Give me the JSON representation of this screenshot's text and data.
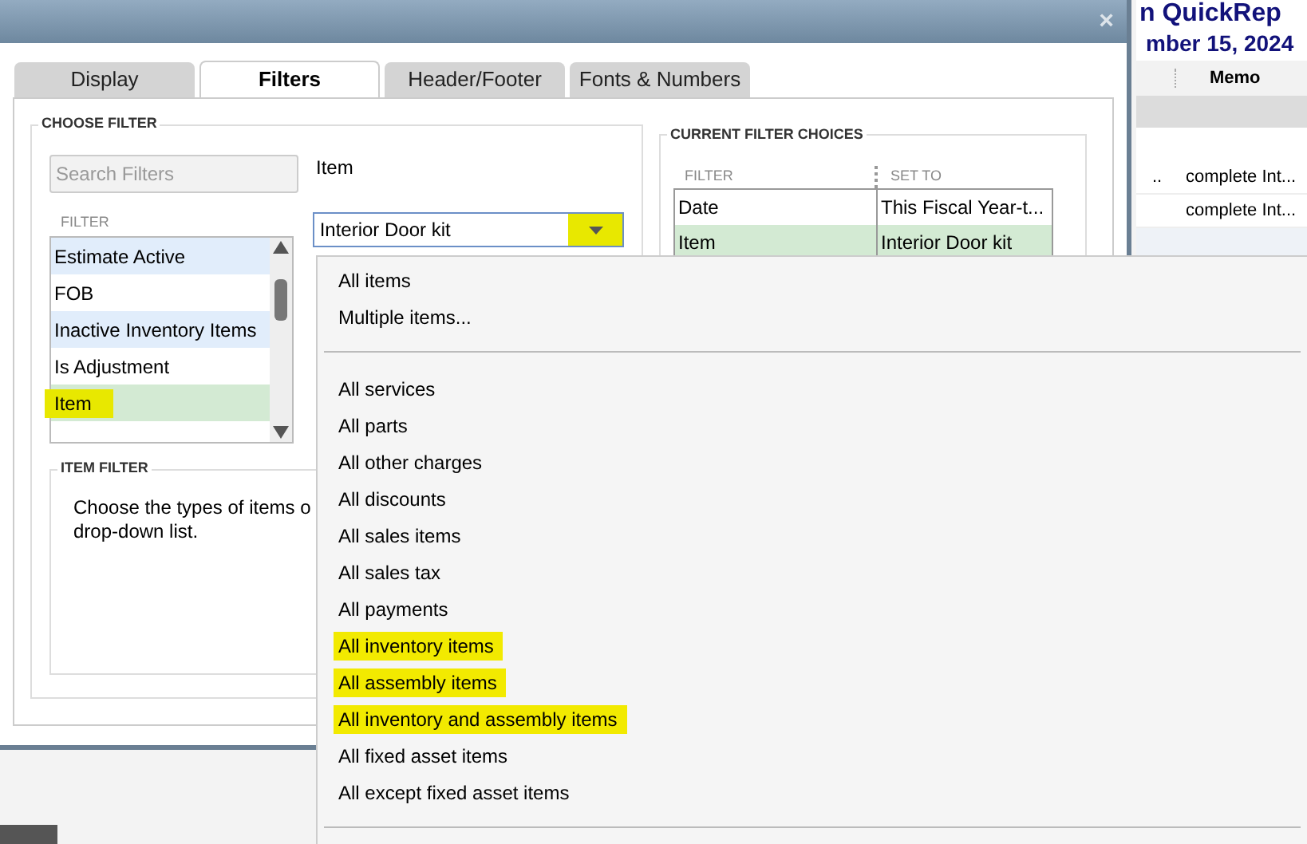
{
  "report": {
    "title": "n QuickRep",
    "subtitle": "mber 15, 2024",
    "memo_heading": "Memo",
    "rows": [
      {
        "cells": [
          "..",
          "complete Int..."
        ]
      },
      {
        "cells": [
          "",
          "complete Int..."
        ]
      }
    ]
  },
  "dialog": {
    "close": "×",
    "tabs": [
      {
        "label": "Display",
        "selected": false
      },
      {
        "label": "Filters",
        "selected": true
      },
      {
        "label": "Header/Footer",
        "selected": false
      },
      {
        "label": "Fonts & Numbers",
        "selected": false
      }
    ],
    "choose_filter": {
      "heading": "CHOOSE FILTER",
      "search": {
        "placeholder": "Search Filters"
      },
      "list_heading": "FILTER",
      "items": [
        {
          "label": "Estimate Active",
          "selected": false,
          "highlighted": false
        },
        {
          "label": "FOB",
          "selected": false,
          "highlighted": false
        },
        {
          "label": "Inactive Inventory Items",
          "selected": false,
          "highlighted": false
        },
        {
          "label": "Is Adjustment",
          "selected": false,
          "highlighted": false
        },
        {
          "label": "Item",
          "selected": true,
          "highlighted": true
        }
      ],
      "field_label": "Item",
      "combo": {
        "value": "Interior Door kit",
        "arrow_highlighted": true
      }
    },
    "item_filter": {
      "heading": "ITEM FILTER",
      "lines": [
        "Choose the types of items o",
        "drop-down list."
      ]
    },
    "current": {
      "heading": "CURRENT FILTER CHOICES",
      "columns": [
        "FILTER",
        "SET TO"
      ],
      "rows": [
        {
          "filter": "Date",
          "set_to": "This Fiscal Year-t...",
          "selected": false
        },
        {
          "filter": "Item",
          "set_to": "Interior Door kit",
          "selected": true
        }
      ]
    }
  },
  "dropdown": {
    "groups": [
      [
        {
          "label": "All items",
          "highlighted": false
        },
        {
          "label": "Multiple items...",
          "highlighted": false
        }
      ],
      [
        {
          "label": "All services",
          "highlighted": false
        },
        {
          "label": "All parts",
          "highlighted": false
        },
        {
          "label": "All other charges",
          "highlighted": false
        },
        {
          "label": "All discounts",
          "highlighted": false
        },
        {
          "label": "All sales items",
          "highlighted": false
        },
        {
          "label": "All sales tax",
          "highlighted": false
        },
        {
          "label": "All payments",
          "highlighted": false
        },
        {
          "label": "All inventory items",
          "highlighted": true
        },
        {
          "label": "All assembly items",
          "highlighted": true
        },
        {
          "label": "All inventory and assembly items",
          "highlighted": true
        },
        {
          "label": "All fixed asset items",
          "highlighted": false
        },
        {
          "label": "All except fixed asset items",
          "highlighted": false
        }
      ]
    ]
  }
}
